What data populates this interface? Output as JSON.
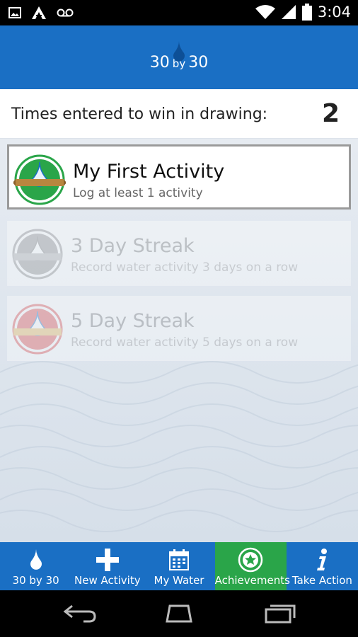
{
  "status_bar": {
    "time": "3:04",
    "left_icons": [
      "image-icon",
      "a-logo-icon",
      "voicemail-icon"
    ],
    "right_icons": [
      "wifi-icon",
      "signal-icon",
      "battery-icon"
    ]
  },
  "header": {
    "title_prefix": "30",
    "title_by": "by",
    "title_suffix": "30"
  },
  "drawing": {
    "label": "Times entered to win in drawing:",
    "count": "2"
  },
  "achievements": [
    {
      "title": "My First Activity",
      "subtitle": "Log at least 1 activity",
      "unlocked": true,
      "badge_color": "#2aa549"
    },
    {
      "title": "3 Day Streak",
      "subtitle": "Record water activity 3 days on a row",
      "unlocked": false,
      "badge_color": "#8a8a8a"
    },
    {
      "title": "5 Day Streak",
      "subtitle": "Record water activity 5 days on a row",
      "unlocked": false,
      "badge_color": "#e04a4a"
    }
  ],
  "bottom_nav": [
    {
      "label": "30 by 30",
      "icon": "water-drop-icon"
    },
    {
      "label": "New Activity",
      "icon": "plus-icon"
    },
    {
      "label": "My Water",
      "icon": "calendar-icon"
    },
    {
      "label": "Achievements",
      "icon": "star-badge-icon",
      "selected": true
    },
    {
      "label": "Take Action",
      "icon": "info-icon"
    }
  ],
  "colors": {
    "primary_blue": "#1a6fc4",
    "selected_green": "#2aa549"
  }
}
